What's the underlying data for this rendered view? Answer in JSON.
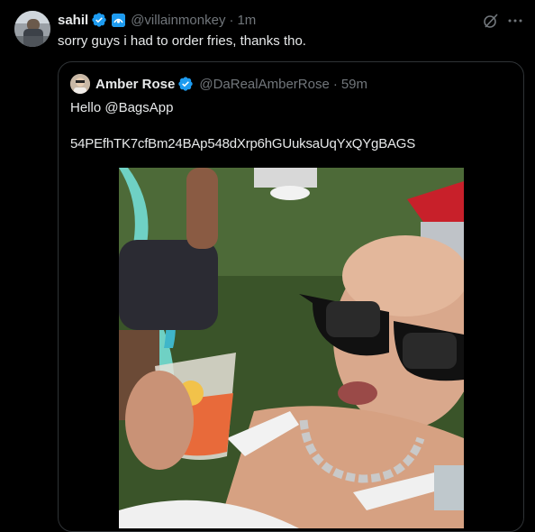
{
  "post": {
    "author_name": "sahil",
    "author_handle": "@villainmonkey",
    "separator": "·",
    "timestamp": "1m",
    "text": "sorry guys i had to order fries, thanks tho.",
    "icons": {
      "verified": "verified-badge-icon",
      "affiliation": "affiliation-badge-icon",
      "grok": "grok-icon",
      "more": "more-options-icon"
    }
  },
  "quoted_post": {
    "author_name": "Amber Rose",
    "author_handle": "@DaRealAmberRose",
    "separator": "·",
    "timestamp": "59m",
    "line1": "Hello @BagsApp",
    "line2": "54PEfhTK7cfBm24BAp548dXrp6hGUuksaUqYxQYgBAGS"
  },
  "colors": {
    "background": "#000000",
    "text_primary": "#e7e9ea",
    "text_secondary": "#71767b",
    "verified_blue": "#1d9bf0",
    "border": "#2f3336"
  }
}
